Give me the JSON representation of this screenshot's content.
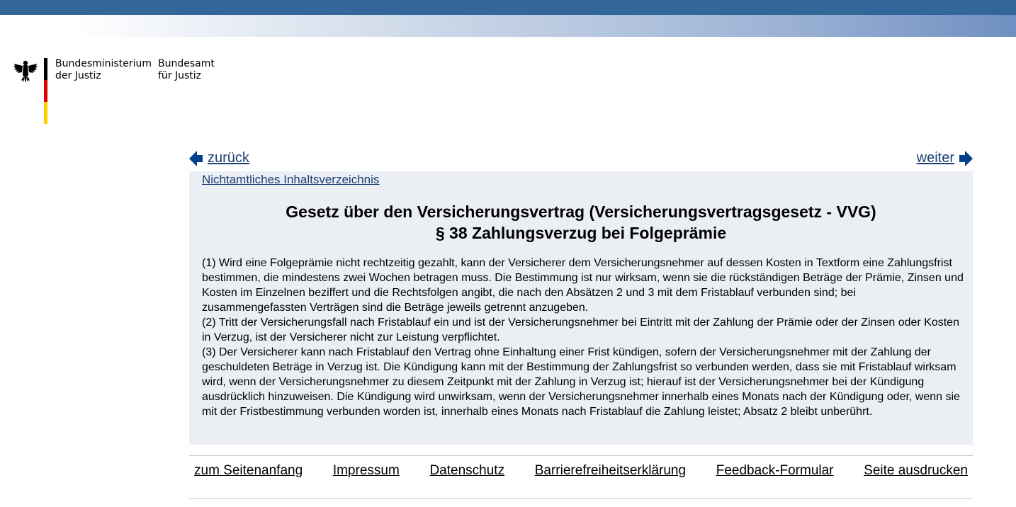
{
  "header": {
    "org1_line1": "Bundesministerium",
    "org1_line2": "der Justiz",
    "org2_line1": "Bundesamt",
    "org2_line2": "für Justiz",
    "colors": {
      "topbar": "#336699",
      "flag_black": "#000000",
      "flag_red": "#dd0000",
      "flag_gold": "#ffcc00"
    }
  },
  "nav": {
    "prev_label": "zurück",
    "next_label": "weiter",
    "prev_icon": "arrow-left-icon",
    "next_icon": "arrow-right-icon"
  },
  "content": {
    "toc_link": "Nichtamtliches Inhaltsverzeichnis",
    "title_line1": "Gesetz über den Versicherungsvertrag (Versicherungsvertragsgesetz - VVG)",
    "title_line2": "§ 38 Zahlungsverzug bei Folgeprämie",
    "paragraphs": [
      "(1) Wird eine Folgeprämie nicht rechtzeitig gezahlt, kann der Versicherer dem Versicherungsnehmer auf dessen Kosten in Textform eine Zahlungsfrist bestimmen, die mindestens zwei Wochen betragen muss. Die Bestimmung ist nur wirksam, wenn sie die rückständigen Beträge der Prämie, Zinsen und Kosten im Einzelnen beziffert und die Rechtsfolgen angibt, die nach den Absätzen 2 und 3 mit dem Fristablauf verbunden sind; bei zusammengefassten Verträgen sind die Beträge jeweils getrennt anzugeben.",
      "(2) Tritt der Versicherungsfall nach Fristablauf ein und ist der Versicherungsnehmer bei Eintritt mit der Zahlung der Prämie oder der Zinsen oder Kosten in Verzug, ist der Versicherer nicht zur Leistung verpflichtet.",
      "(3) Der Versicherer kann nach Fristablauf den Vertrag ohne Einhaltung einer Frist kündigen, sofern der Versicherungsnehmer mit der Zahlung der geschuldeten Beträge in Verzug ist. Die Kündigung kann mit der Bestimmung der Zahlungsfrist so verbunden werden, dass sie mit Fristablauf wirksam wird, wenn der Versicherungsnehmer zu diesem Zeitpunkt mit der Zahlung in Verzug ist; hierauf ist der Versicherungsnehmer bei der Kündigung ausdrücklich hinzuweisen. Die Kündigung wird unwirksam, wenn der Versicherungsnehmer innerhalb eines Monats nach der Kündigung oder, wenn sie mit der Fristbestimmung verbunden worden ist, innerhalb eines Monats nach Fristablauf die Zahlung leistet; Absatz 2 bleibt unberührt."
    ]
  },
  "footer": {
    "links": [
      "zum Seitenanfang",
      "Impressum",
      "Datenschutz",
      "Barrierefreiheitserklärung",
      "Feedback-Formular",
      "Seite ausdrucken"
    ]
  }
}
